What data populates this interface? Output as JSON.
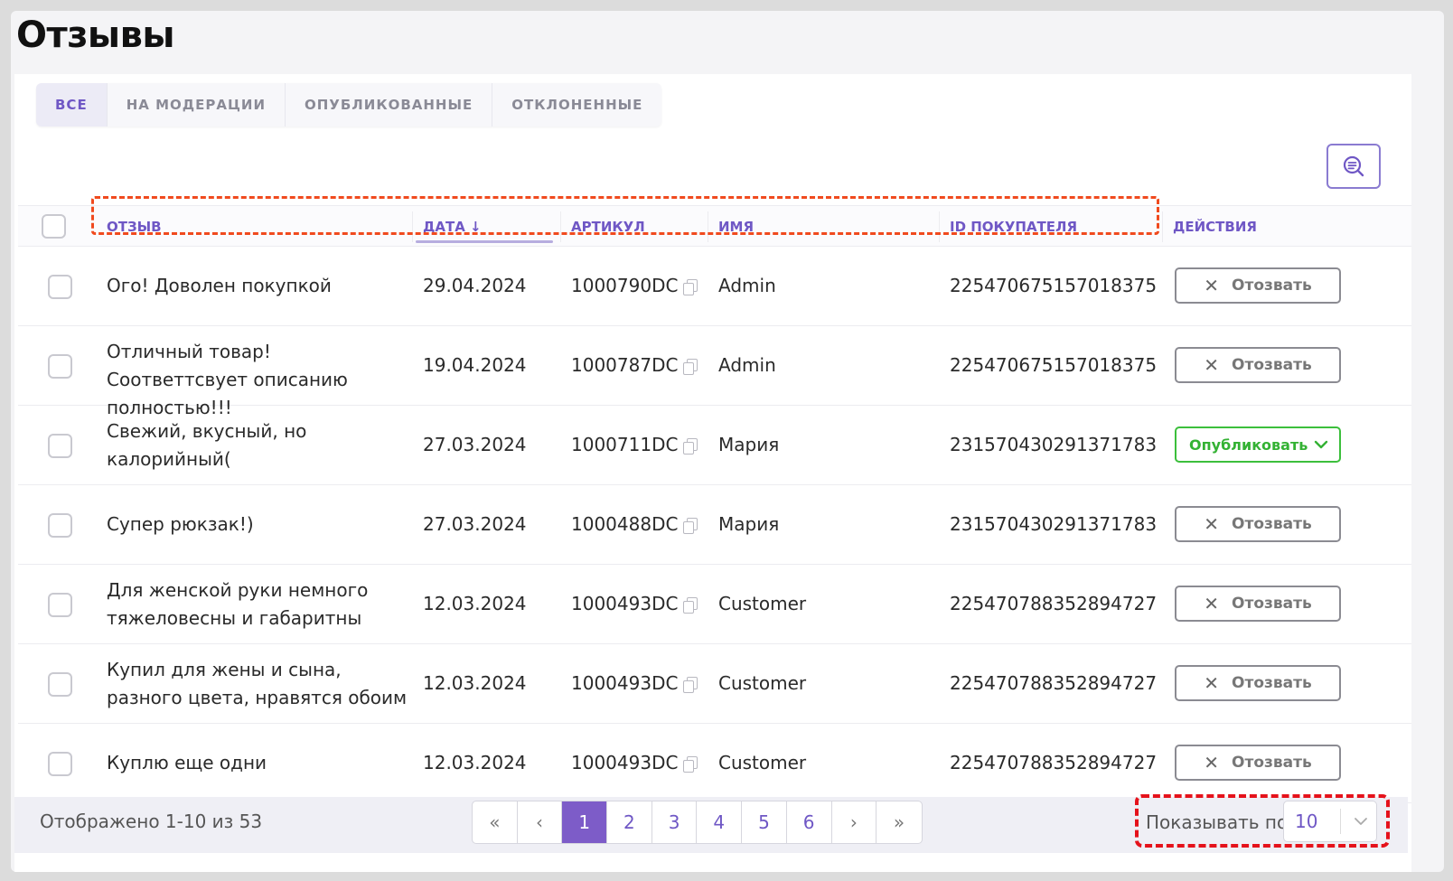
{
  "page_title": "Отзывы",
  "tabs": [
    {
      "label": "ВСЕ",
      "active": true
    },
    {
      "label": "НА МОДЕРАЦИИ",
      "active": false
    },
    {
      "label": "ОПУБЛИКОВАННЫЕ",
      "active": false
    },
    {
      "label": "ОТКЛОНЕННЫЕ",
      "active": false
    }
  ],
  "search_icon": "search-list-icon",
  "columns": {
    "review": "ОТЗЫВ",
    "date": "ДАТА ↓",
    "sku": "АРТИКУЛ",
    "name": "ИМЯ",
    "buyer_id": "ID ПОКУПАТЕЛЯ",
    "actions": "ДЕЙСТВИЯ"
  },
  "rows": [
    {
      "review": "Ого! Доволен покупкой",
      "date": "29.04.2024",
      "sku": "1000790DC",
      "name": "Admin",
      "buyer_id": "225470675157018375",
      "action": "revoke",
      "action_label": "Отозвать"
    },
    {
      "review": "Отличный товар! Соответтсвует описанию полностью!!!",
      "date": "19.04.2024",
      "sku": "1000787DC",
      "name": "Admin",
      "buyer_id": "225470675157018375",
      "action": "revoke",
      "action_label": "Отозвать"
    },
    {
      "review": "Свежий, вкусный, но калорийный(",
      "date": "27.03.2024",
      "sku": "1000711DC",
      "name": "Мария",
      "buyer_id": "231570430291371783",
      "action": "publish",
      "action_label": "Опубликовать"
    },
    {
      "review": "Супер рюкзак!)",
      "date": "27.03.2024",
      "sku": "1000488DC",
      "name": "Мария",
      "buyer_id": "231570430291371783",
      "action": "revoke",
      "action_label": "Отозвать"
    },
    {
      "review": "Для женской руки немного тяжеловесны и габаритны",
      "date": "12.03.2024",
      "sku": "1000493DC",
      "name": "Customer",
      "buyer_id": "225470788352894727",
      "action": "revoke",
      "action_label": "Отозвать"
    },
    {
      "review": "Купил для жены и сына, разного цвета, нравятся обоим",
      "date": "12.03.2024",
      "sku": "1000493DC",
      "name": "Customer",
      "buyer_id": "225470788352894727",
      "action": "revoke",
      "action_label": "Отозвать"
    },
    {
      "review": "Куплю еще одни",
      "date": "12.03.2024",
      "sku": "1000493DC",
      "name": "Customer",
      "buyer_id": "225470788352894727",
      "action": "revoke",
      "action_label": "Отозвать"
    }
  ],
  "footer": {
    "shown": "Отображено 1-10 из 53",
    "pages": [
      "«",
      "‹",
      "1",
      "2",
      "3",
      "4",
      "5",
      "6",
      "›",
      "»"
    ],
    "current_page": "1",
    "per_page_label": "Показывать по",
    "per_page_value": "10"
  },
  "colors": {
    "accent": "#7d5cc8",
    "publish": "#3cbf3c",
    "highlight_orange": "#f04a1e",
    "highlight_red": "#e5121b"
  }
}
